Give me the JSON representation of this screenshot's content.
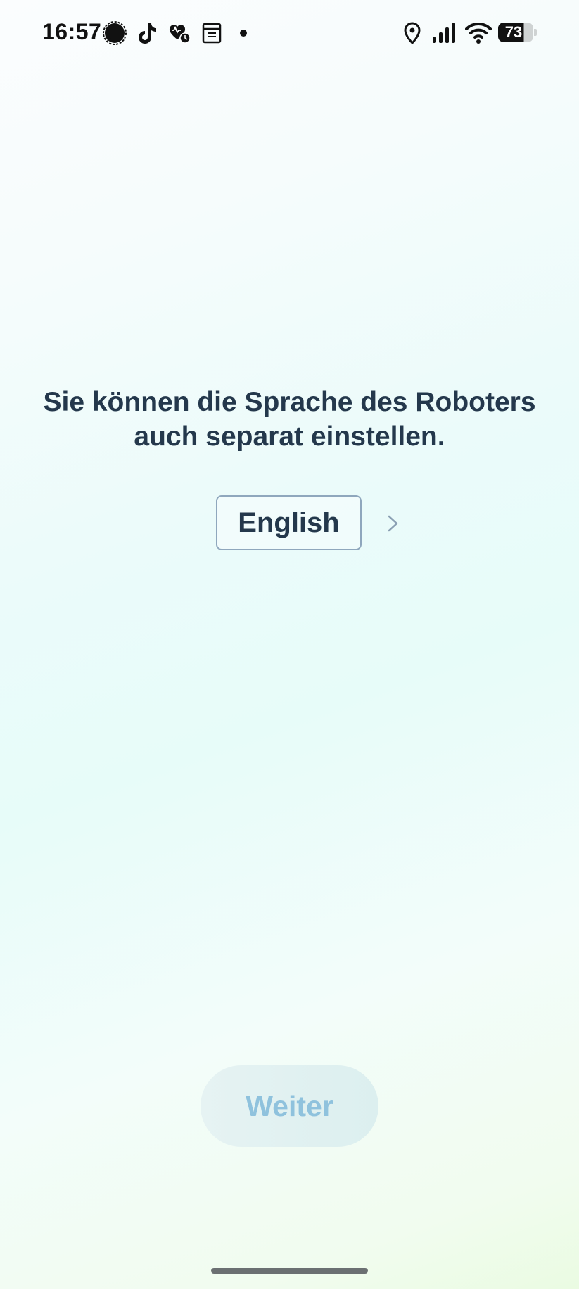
{
  "status_bar": {
    "time": "16:57",
    "left_icons": [
      "signal-messenger-icon",
      "tiktok-icon",
      "health-app-icon",
      "calendar-app-icon",
      "notification-dot-icon"
    ],
    "right_icons": [
      "location-icon",
      "cellular-signal-icon",
      "wifi-icon"
    ],
    "battery_level": "73"
  },
  "main": {
    "headline": "Sie können die Sprache des Roboters auch separat einstellen.",
    "language_button_label": "English",
    "chevron_icon": "chevron-right-icon"
  },
  "footer": {
    "next_button_label": "Weiter"
  },
  "colors": {
    "text_primary": "#24384c",
    "button_border": "#8fa7bd",
    "next_button_text": "#8fc2dd",
    "next_button_bg": "#dcefef"
  }
}
